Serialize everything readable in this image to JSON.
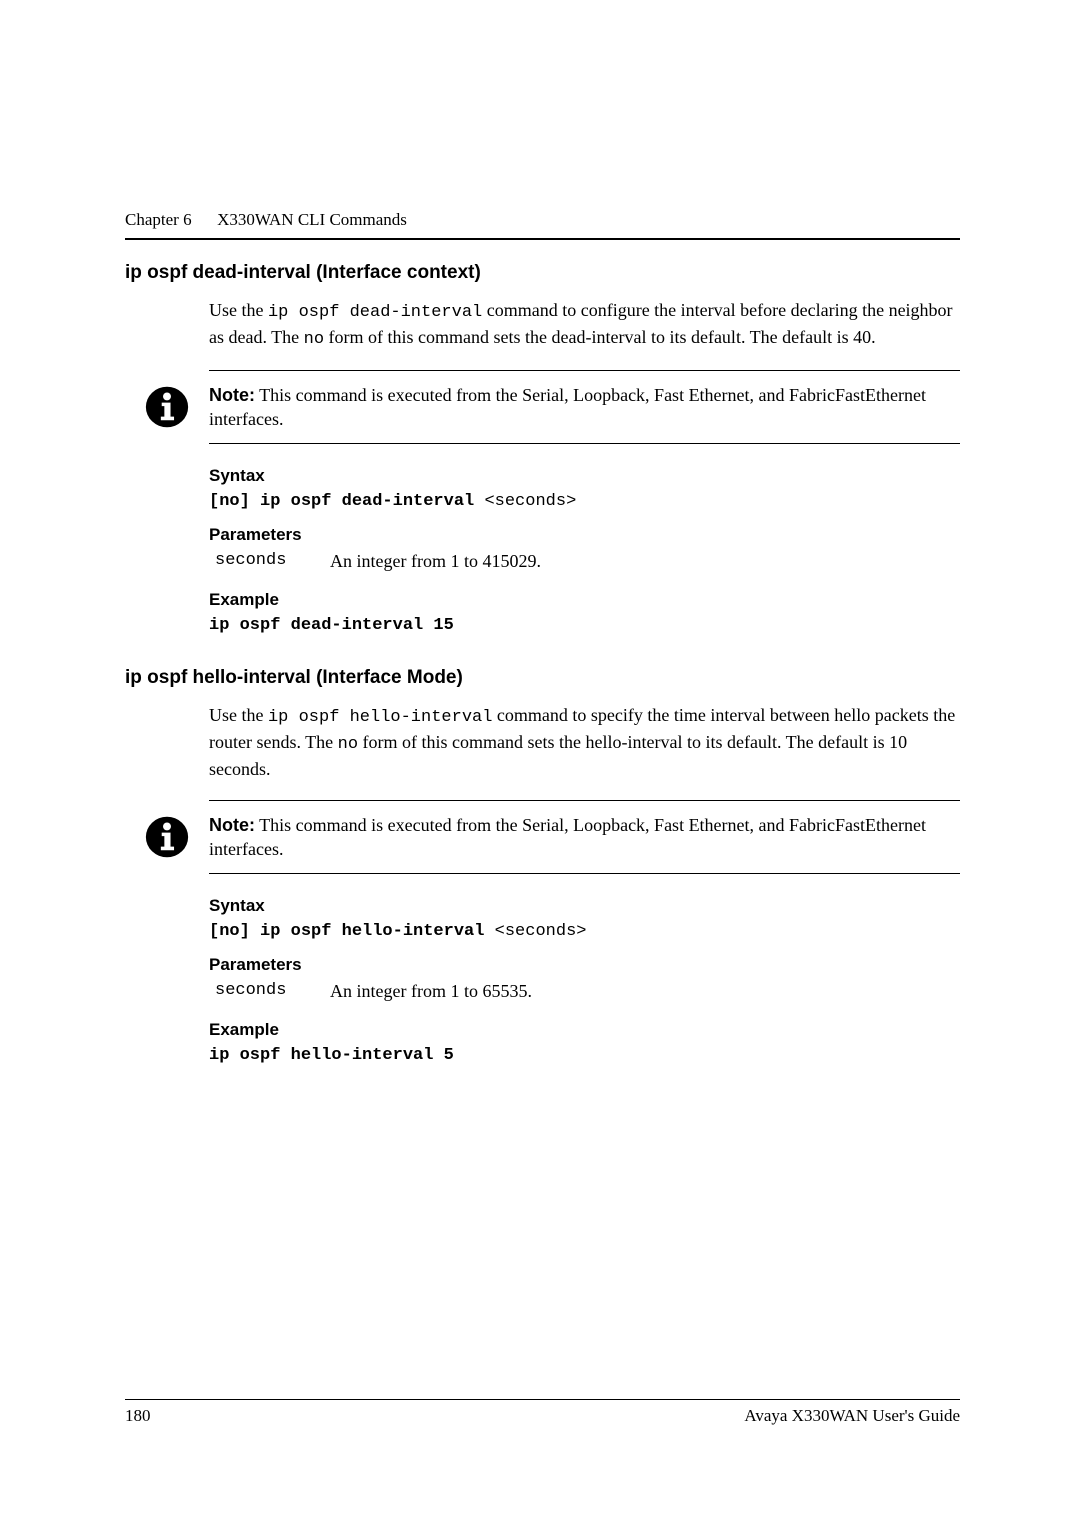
{
  "header": {
    "chapter_label": "Chapter 6",
    "chapter_title": "X330WAN CLI Commands"
  },
  "sections": [
    {
      "title": "ip ospf dead-interval (Interface context)",
      "intro": {
        "pre1": "Use the ",
        "mono1": "ip ospf dead-interval",
        "mid1": " command to configure the interval before declaring the neighbor as dead. The ",
        "mono2": "no",
        "post1": " form of this command sets the dead-interval to its default. The default is 40."
      },
      "note": {
        "label": "Note:",
        "text": "  This command is executed from the Serial, Loopback, Fast Ethernet, and FabricFastEthernet interfaces."
      },
      "syntax": {
        "heading": "Syntax",
        "bold": "[no] ip ospf dead-interval",
        "arg": " <seconds>"
      },
      "parameters": {
        "heading": "Parameters",
        "rows": [
          {
            "name": "seconds",
            "desc": "An integer from 1 to 415029."
          }
        ]
      },
      "example": {
        "heading": "Example",
        "code": "ip ospf dead-interval 15"
      }
    },
    {
      "title": "ip ospf hello-interval (Interface Mode)",
      "intro": {
        "pre1": "Use the ",
        "mono1": "ip ospf hello-interval",
        "mid1": " command to specify the time interval between hello packets the router sends. The ",
        "mono2": "no",
        "post1": " form of this command sets the hello-interval to its default. The default is 10 seconds."
      },
      "note": {
        "label": "Note:",
        "text": "  This command is executed from the Serial, Loopback, Fast Ethernet, and FabricFastEthernet interfaces."
      },
      "syntax": {
        "heading": "Syntax",
        "bold": "[no] ip ospf hello-interval",
        "arg": " <seconds>"
      },
      "parameters": {
        "heading": "Parameters",
        "rows": [
          {
            "name": "seconds",
            "desc": "An integer from 1 to 65535."
          }
        ]
      },
      "example": {
        "heading": "Example",
        "code": "ip ospf hello-interval 5"
      }
    }
  ],
  "footer": {
    "page_number": "180",
    "doc_title": "Avaya X330WAN User's Guide"
  }
}
